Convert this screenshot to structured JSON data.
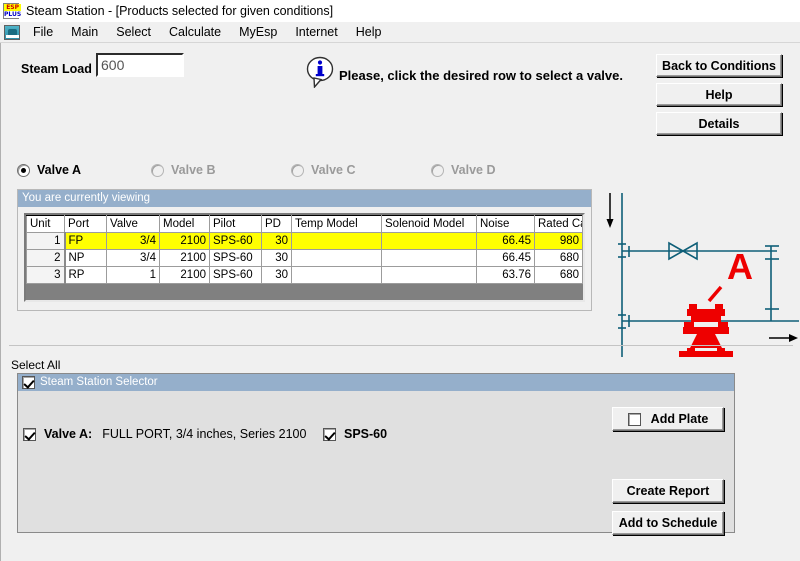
{
  "window": {
    "title": "Steam Station - [Products selected for given conditions]",
    "app_icon": "esp-plus-logo-icon",
    "icon_top_text": "ESP",
    "icon_bottom_text": "PLUS"
  },
  "menubar": {
    "icon": "application-window-icon",
    "items": [
      {
        "label": "File"
      },
      {
        "label": "Main"
      },
      {
        "label": "Select"
      },
      {
        "label": "Calculate"
      },
      {
        "label": "MyEsp"
      },
      {
        "label": "Internet"
      },
      {
        "label": "Help"
      }
    ]
  },
  "toolbar": {
    "steam_load_label": "Steam Load",
    "steam_load_value": "600",
    "steam_load_placeholder": "",
    "info_icon": "information-balloon-icon",
    "hint_text": "Please, click the desired row to select a valve.",
    "back_button": "Back to Conditions",
    "help_button": "Help",
    "details_button": "Details"
  },
  "valve_tabs": {
    "options": [
      {
        "label": "Valve A",
        "selected": true,
        "enabled": true
      },
      {
        "label": "Valve B",
        "selected": false,
        "enabled": false
      },
      {
        "label": "Valve C",
        "selected": false,
        "enabled": false
      },
      {
        "label": "Valve D",
        "selected": false,
        "enabled": false
      }
    ]
  },
  "grid": {
    "caption": "You are currently viewing",
    "columns": [
      "Unit",
      "Port",
      "Valve",
      "Model",
      "Pilot",
      "PD",
      "Temp Model",
      "Solenoid Model",
      "Noise",
      "Rated Capacity"
    ],
    "rows": [
      {
        "selected": true,
        "cells": [
          "1",
          "FP",
          "3/4",
          "2100",
          "SPS-60",
          "30",
          "",
          "",
          "66.45",
          "980"
        ]
      },
      {
        "selected": false,
        "cells": [
          "2",
          "NP",
          "3/4",
          "2100",
          "SPS-60",
          "30",
          "",
          "",
          "66.45",
          "680"
        ]
      },
      {
        "selected": false,
        "cells": [
          "3",
          "RP",
          "1",
          "2100",
          "SPS-60",
          "30",
          "",
          "",
          "63.76",
          "680"
        ]
      }
    ]
  },
  "diagram": {
    "name": "piping-schematic-diagram",
    "label": "A",
    "line_color": "#0f5f78",
    "valve_color": "#ee0000",
    "arrow_color": "#000000"
  },
  "bottom": {
    "select_all_label": "Select All",
    "selector_caption": "Steam Station Selector",
    "selector_checked": true,
    "valve_checked": true,
    "valve_name": "Valve A:",
    "valve_description": "FULL PORT, 3/4 inches, Series 2100",
    "sps_checked": true,
    "sps_label": "SPS-60",
    "add_plate_label": "Add Plate",
    "add_plate_checked": false,
    "create_report_label": "Create Report",
    "add_to_schedule_label": "Add to Schedule"
  },
  "colors": {
    "caption_blue": "#95afcb",
    "selected_row_yellow": "#ffff00",
    "face": "#f0f0f0",
    "panel": "#e0e0e0"
  }
}
